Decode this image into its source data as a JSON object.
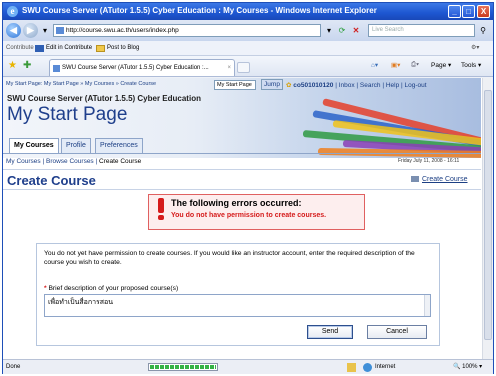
{
  "window": {
    "title": "SWU Course Server (ATutor 1.5.5) Cyber Education : My Courses - Windows Internet Explorer",
    "controls": [
      "_",
      "□",
      "X"
    ]
  },
  "browser": {
    "url": "http://course.swu.ac.th/users/index.php",
    "search_placeholder": "Live Search",
    "links": [
      "Contribute",
      "Edit in Contribute",
      "Post to Blog"
    ],
    "tab_title": "SWU Course Server (ATutor 1.5.5) Cyber Education :...",
    "commands": [
      "Page ▾",
      "Tools ▾"
    ],
    "status_text": "Done",
    "zone_text": "Internet",
    "zoom_text": "100%",
    "progress": 1.0
  },
  "page": {
    "breadcrumb": "My Start Page: My Start Page » My Courses » Create Course",
    "jump_select": "My Start Page",
    "jump_button": "Jump",
    "user_link": "co501010120",
    "top_links": [
      "Inbox",
      "Search",
      "Help",
      "Log-out"
    ],
    "course_server_title": "SWU Course Server (ATutor 1.5.5) Cyber Education",
    "start_page_title": "My Start Page",
    "tabs": [
      {
        "label": "My Courses",
        "active": true
      },
      {
        "label": "Profile",
        "active": false
      },
      {
        "label": "Preferences",
        "active": false
      }
    ],
    "subnav": {
      "link1": "My Courses",
      "link2": "Browse Courses",
      "current": "Create Course"
    },
    "date": "Friday July 11, 2008 - 16:11",
    "heading": "Create Course",
    "create_course_link": "Create Course",
    "error": {
      "title": "The following errors occurred:",
      "message": "You do not have permission to create courses."
    },
    "form": {
      "intro": "You do not yet have permission to create courses. If you would like an instructor account, enter the required description of the course you wish to create.",
      "field_label": "Brief description of your proposed course(s)",
      "field_value": "เพื่อทำเป็นสื่อการสอน",
      "send_label": "Send",
      "cancel_label": "Cancel"
    }
  }
}
